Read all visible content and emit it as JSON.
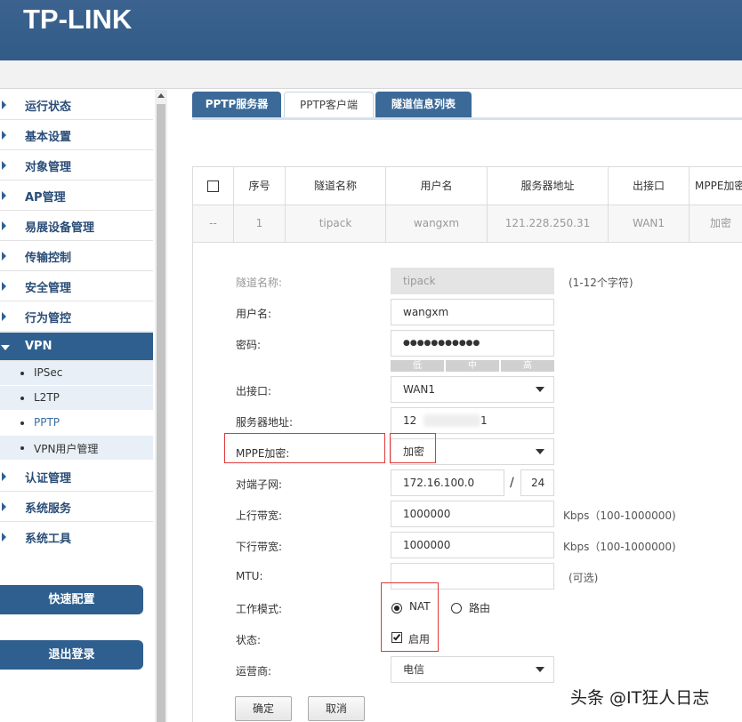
{
  "brand": "TP-LINK",
  "sidebar": {
    "items": [
      {
        "label": "运行状态"
      },
      {
        "label": "基本设置"
      },
      {
        "label": "对象管理"
      },
      {
        "label": "AP管理"
      },
      {
        "label": "易展设备管理"
      },
      {
        "label": "传输控制"
      },
      {
        "label": "安全管理"
      },
      {
        "label": "行为管控"
      },
      {
        "label": "VPN"
      },
      {
        "label": "认证管理"
      },
      {
        "label": "系统服务"
      },
      {
        "label": "系统工具"
      }
    ],
    "vpn_sub": [
      {
        "label": "IPSec"
      },
      {
        "label": "L2TP"
      },
      {
        "label": "PPTP"
      },
      {
        "label": "VPN用户管理"
      }
    ],
    "quick_config": "快速配置",
    "logout": "退出登录"
  },
  "tabs": [
    {
      "label": "PPTP服务器"
    },
    {
      "label": "PPTP客户端"
    },
    {
      "label": "隧道信息列表"
    }
  ],
  "table": {
    "headers": [
      "序号",
      "隧道名称",
      "用户名",
      "服务器地址",
      "出接口",
      "MPPE加密"
    ],
    "row": {
      "dash": "--",
      "index": "1",
      "tunnel": "tipack",
      "user": "wangxm",
      "server": "121.228.250.31",
      "iface": "WAN1",
      "mppe": "加密"
    }
  },
  "form": {
    "tunnel_name": {
      "label": "隧道名称:",
      "value": "tipack",
      "hint": "(1-12个字符)"
    },
    "username": {
      "label": "用户名:",
      "value": "wangxm"
    },
    "password": {
      "label": "密码:",
      "value": "●●●●●●●●●●●"
    },
    "strength": [
      "低",
      "中",
      "高"
    ],
    "out_iface": {
      "label": "出接口:",
      "value": "WAN1"
    },
    "server_addr": {
      "label": "服务器地址:",
      "value_start": "12",
      "value_end": "1"
    },
    "mppe": {
      "label": "MPPE加密:",
      "value": "加密"
    },
    "peer_subnet": {
      "label": "对端子网:",
      "ip": "172.16.100.0",
      "sep": "/",
      "mask": "24"
    },
    "up_bw": {
      "label": "上行带宽:",
      "value": "1000000",
      "hint": "Kbps（100-1000000)"
    },
    "down_bw": {
      "label": "下行带宽:",
      "value": "1000000",
      "hint": "Kbps（100-1000000)"
    },
    "mtu": {
      "label": "MTU:",
      "value": "",
      "hint": "(可选)"
    },
    "work_mode": {
      "label": "工作模式:",
      "options": [
        "NAT",
        "路由"
      ],
      "selected": "NAT"
    },
    "status": {
      "label": "状态:",
      "option": "启用",
      "checked": true
    },
    "isp": {
      "label": "运营商:",
      "value": "电信"
    },
    "ok": "确定",
    "cancel": "取消"
  },
  "watermark": "头条 @IT狂人日志"
}
